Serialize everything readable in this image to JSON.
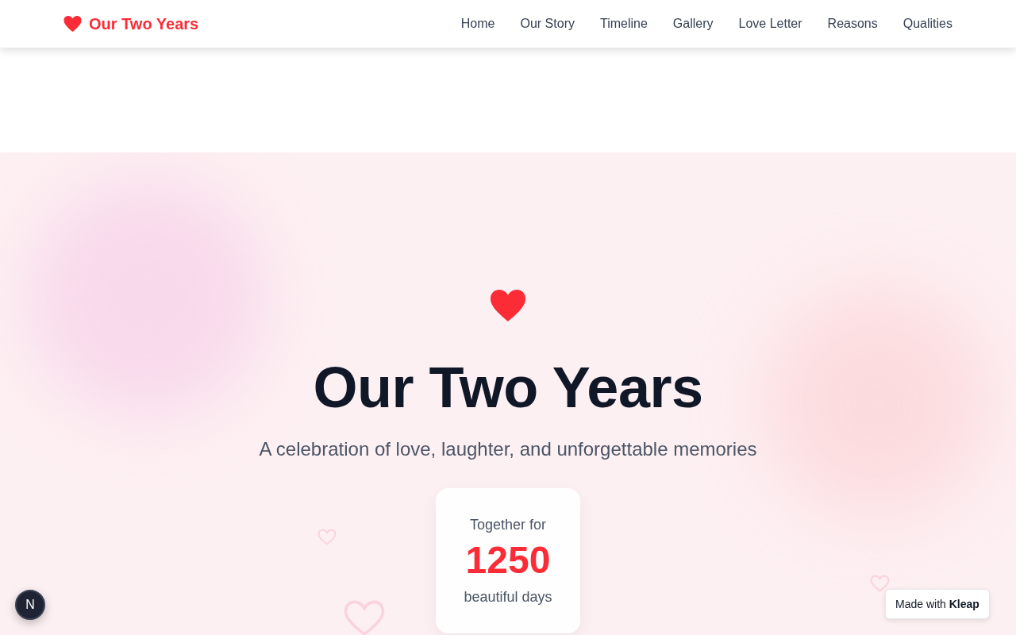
{
  "header": {
    "brand": {
      "label": "Our Two Years"
    },
    "nav": [
      {
        "label": "Home"
      },
      {
        "label": "Our Story"
      },
      {
        "label": "Timeline"
      },
      {
        "label": "Gallery"
      },
      {
        "label": "Love Letter"
      },
      {
        "label": "Reasons"
      },
      {
        "label": "Qualities"
      }
    ]
  },
  "hero": {
    "title": "Our Two Years",
    "subtitle": "A celebration of love, laughter, and unforgettable memories",
    "counter": {
      "caption": "Together for",
      "value": "1250",
      "unit": "beautiful days"
    }
  },
  "dev_badge": {
    "label": "N"
  },
  "made_with_badge": {
    "text": "Made with **Kleap**"
  }
}
